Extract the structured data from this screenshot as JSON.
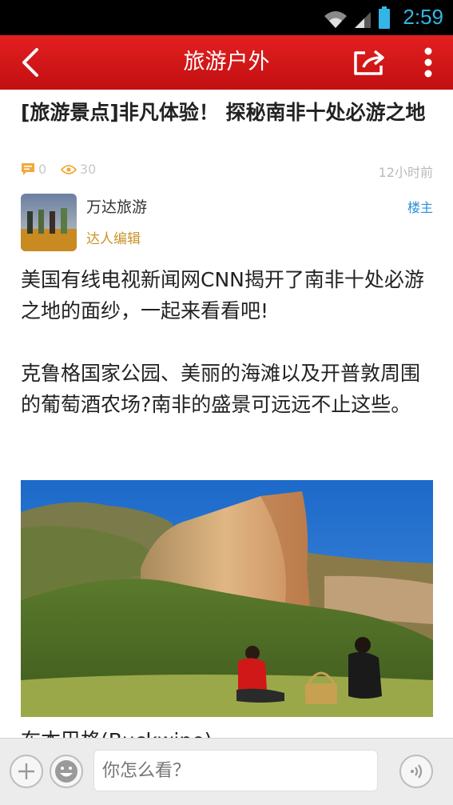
{
  "status_bar": {
    "time": "2:59"
  },
  "header": {
    "title": "旅游户外"
  },
  "article": {
    "title": "[旅游景点]非凡体验！ 探秘南非十处必游之地",
    "comment_count": "0",
    "view_count": "30",
    "time_ago": "12小时前",
    "author": {
      "name": "万达旅游",
      "role": "达人编辑",
      "tag": "楼主"
    },
    "paragraphs": [
      "美国有线电视新闻网CNN揭开了南非十处必游之地的面纱，一起来看看吧!",
      "克鲁格国家公园、美丽的海滩以及开普敦周围的葡萄酒农场?南非的盛景可远远不止这些。"
    ],
    "tail_text": "布本巴格(Buckwine)"
  },
  "bottom_bar": {
    "input_placeholder": "你怎么看？"
  }
}
